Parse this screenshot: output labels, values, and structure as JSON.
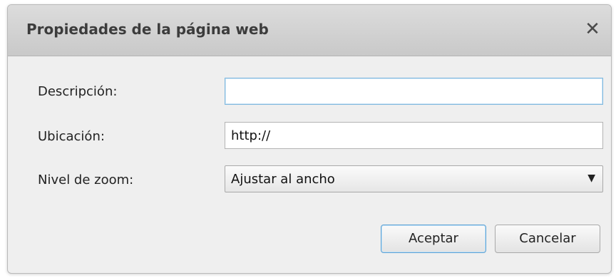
{
  "dialog": {
    "title": "Propiedades de la página web",
    "close_icon": "close-icon"
  },
  "form": {
    "description_label": "Descripción:",
    "description_value": "",
    "location_label": "Ubicación:",
    "location_value": "http://",
    "zoom_label": "Nivel de zoom:",
    "zoom_selected": "Ajustar al ancho"
  },
  "buttons": {
    "accept": "Aceptar",
    "cancel": "Cancelar"
  }
}
